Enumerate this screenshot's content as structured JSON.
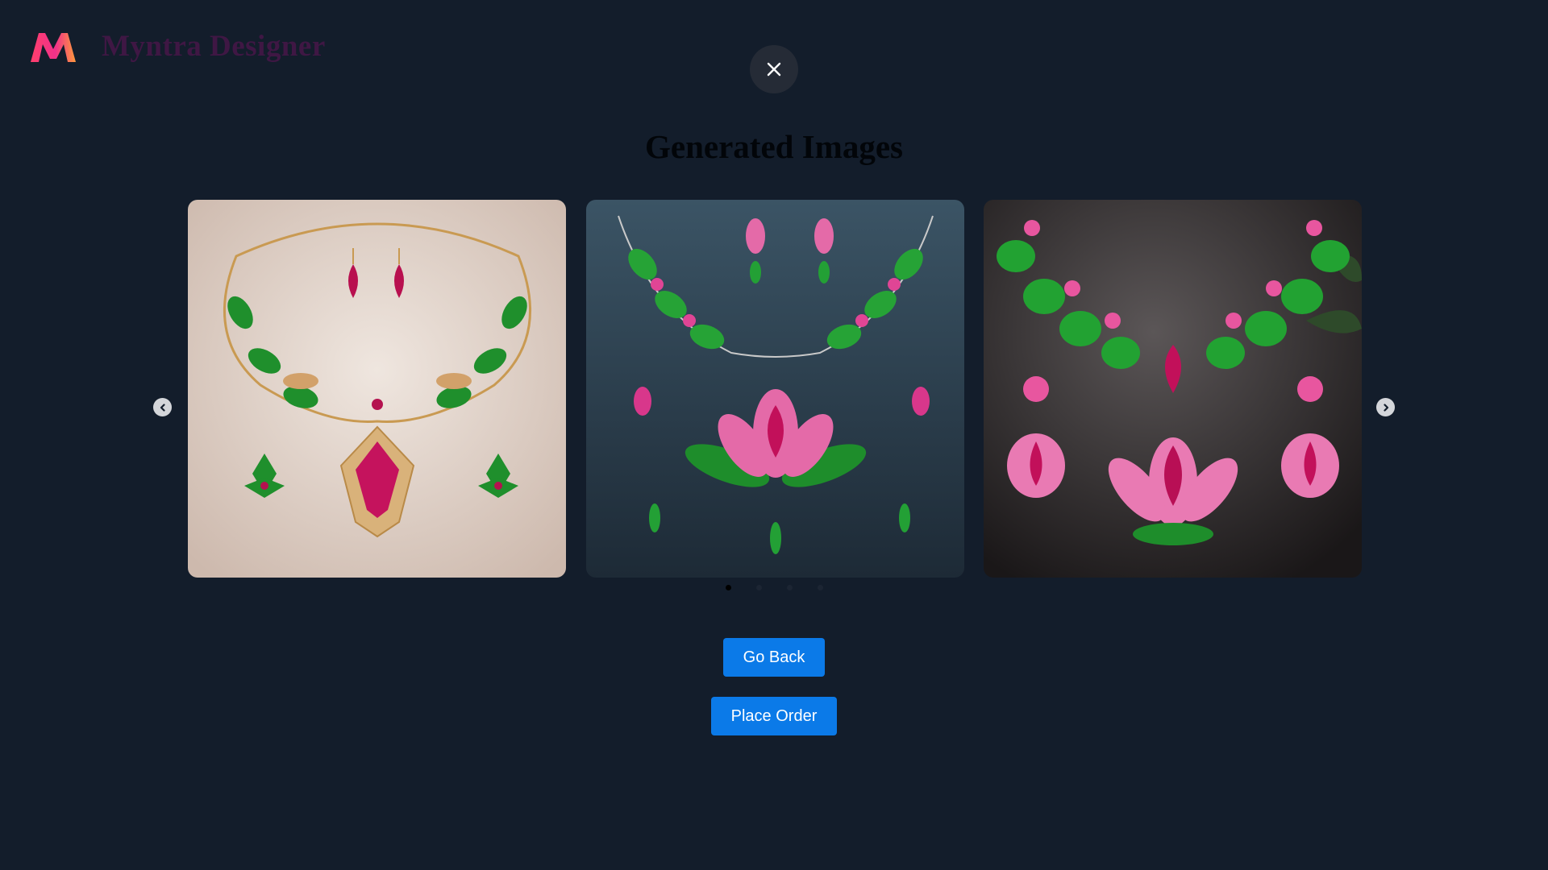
{
  "brand": {
    "name": "Myntra Designer",
    "logo": "myntra-m-logo"
  },
  "close": {
    "icon": "close-icon"
  },
  "heading": "Generated Images",
  "carousel": {
    "slides": [
      {
        "name": "generated-image-1",
        "background": "#e9ddd5",
        "theme": "gold lotus necklace with ruby pendant and earrings"
      },
      {
        "name": "generated-image-2",
        "background": "#2e3f4d",
        "theme": "pink lotus necklace with green leaves and drop earrings"
      },
      {
        "name": "generated-image-3",
        "background": "#3a3638",
        "theme": "green leaf necklace with pink lotus pendant and earrings"
      }
    ],
    "dots": 4,
    "active_dot": 0,
    "prev_icon": "chevron-left-icon",
    "next_icon": "chevron-right-icon"
  },
  "actions": {
    "go_back": "Go Back",
    "place_order": "Place Order"
  },
  "colors": {
    "background": "#131d2b",
    "button": "#0b7ae8",
    "brand_text": "#3f1744"
  }
}
